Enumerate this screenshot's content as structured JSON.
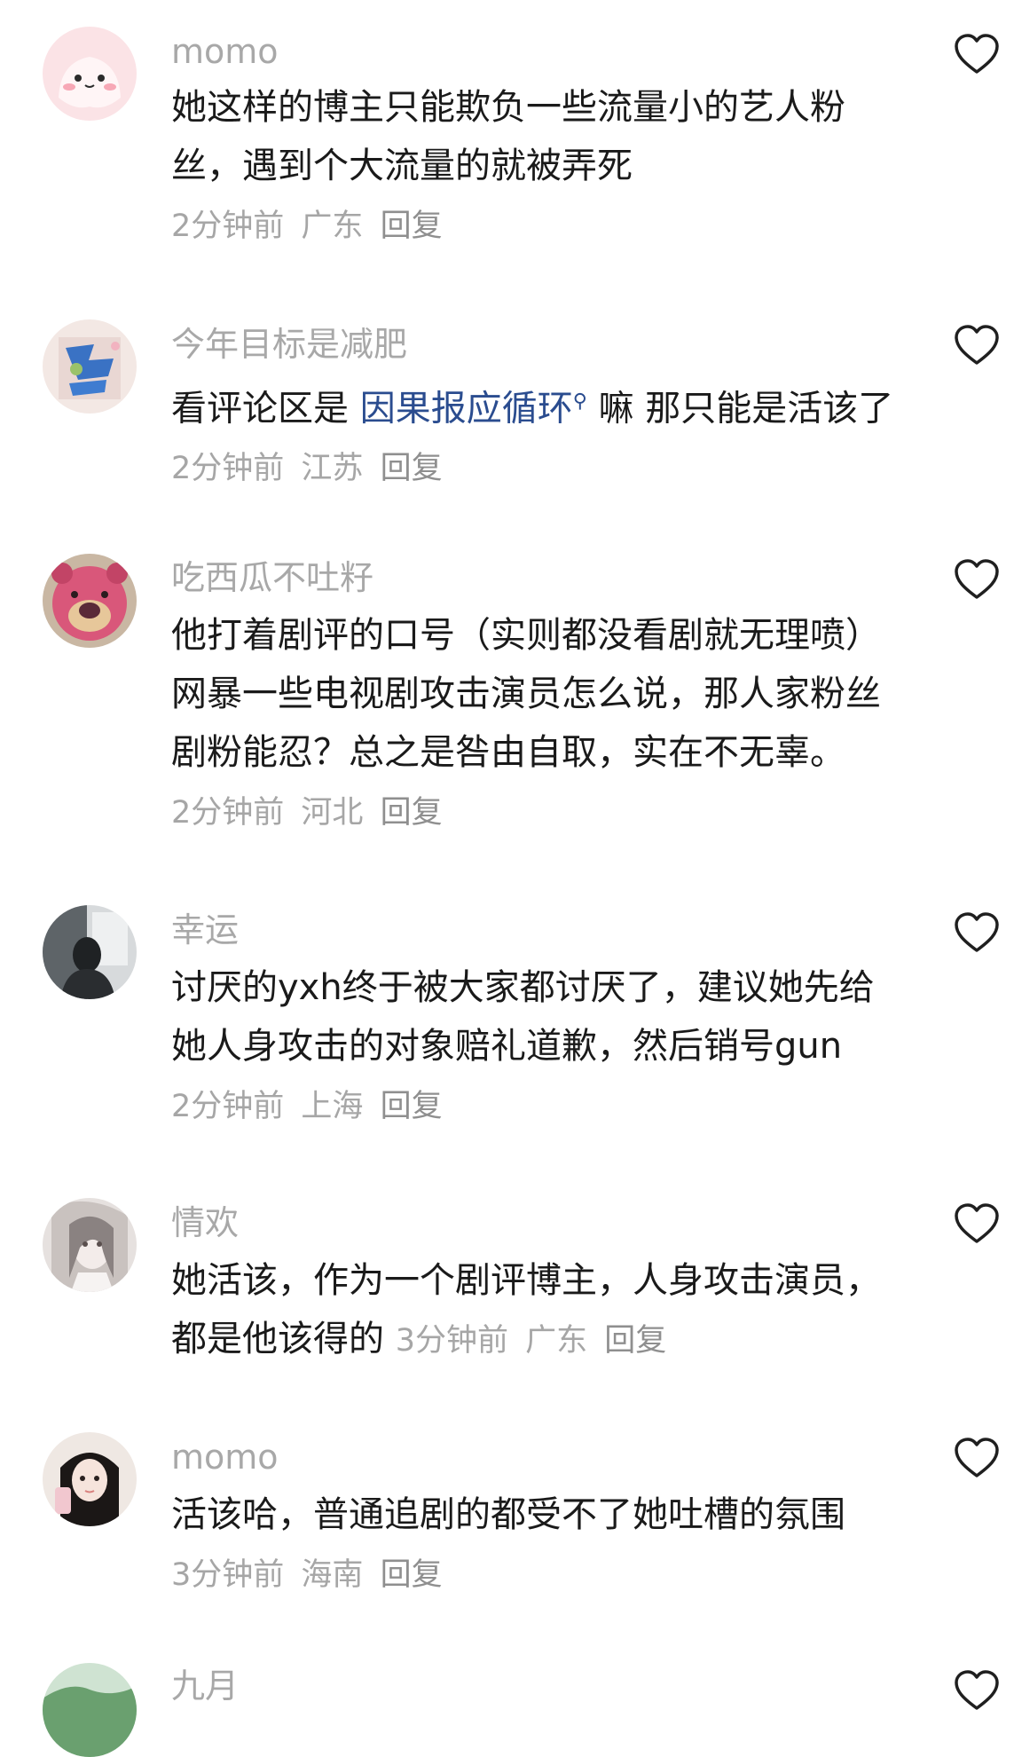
{
  "comments": [
    {
      "username": "momo",
      "text": "她这样的博主只能欺负一些流量小的艺人粉丝，遇到个大流量的就被弄死",
      "time": "2分钟前",
      "location": "广东",
      "reply": "回复",
      "avatar_icon": "pink-blob-avatar"
    },
    {
      "username": "今年目标是减肥",
      "text_before": "看评论区是 ",
      "link": "因果报应循环",
      "text_after": " 嘛 那只能是活该了",
      "time": "2分钟前",
      "location": "江苏",
      "reply": "回复",
      "avatar_icon": "book-cover-avatar"
    },
    {
      "username": "吃西瓜不吐籽",
      "text": "他打着剧评的口号（实则都没看剧就无理喷）网暴一些电视剧攻击演员怎么说，那人家粉丝剧粉能忍？总之是咎由自取，实在不无辜。",
      "time": "2分钟前",
      "location": "河北",
      "reply": "回复",
      "avatar_icon": "strawberry-bear-avatar"
    },
    {
      "username": "幸运",
      "text": "讨厌的yxh终于被大家都讨厌了，建议她先给她人身攻击的对象赔礼道歉，然后销号gun",
      "time": "2分钟前",
      "location": "上海",
      "reply": "回复",
      "avatar_icon": "window-silhouette-avatar"
    },
    {
      "username": "情欢",
      "text": "她活该，作为一个剧评博主，人身攻击演员，都是他该得的",
      "time": "3分钟前",
      "location": "广东",
      "reply": "回复",
      "avatar_icon": "sketch-girl-avatar"
    },
    {
      "username": "momo",
      "text": "活该哈，普通追剧的都受不了她吐槽的氛围",
      "time": "3分钟前",
      "location": "海南",
      "reply": "回复",
      "avatar_icon": "selfie-girl-avatar"
    }
  ],
  "partial_next_username": "九月",
  "icons": {
    "like": "heart-outline-icon"
  },
  "colors": {
    "link": "#2a4c8f",
    "meta": "#a6a6a6",
    "username": "#a8a8a8",
    "text": "#1a1a1a"
  }
}
